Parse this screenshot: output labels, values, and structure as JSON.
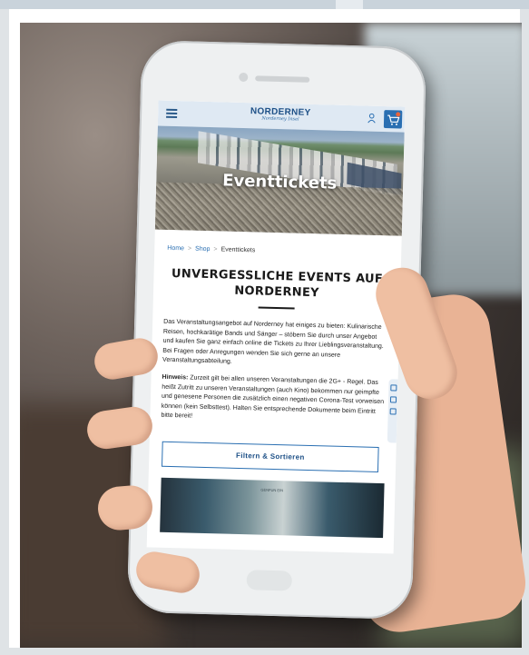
{
  "header": {
    "logo_main": "NORDERNEY",
    "logo_script": "Norderney Insel"
  },
  "hero": {
    "title": "Eventtickets"
  },
  "breadcrumb": {
    "home": "Home",
    "shop": "Shop",
    "current": "Eventtickets",
    "separator": ">"
  },
  "page": {
    "heading": "UNVERGESSLICHE EVENTS AUF NORDERNEY",
    "intro": "Das Veranstaltungsangebot auf Norderney hat einiges zu bieten: Kulinarische Reisen, hochkarätige Bands und Sänger – stöbern Sie durch unser Angebot und kaufen Sie ganz einfach online die Tickets zu Ihrer Lieblingsveranstaltung. Bei Fragen oder Anregungen wenden Sie sich gerne an unsere Veranstaltungsabteilung.",
    "notice_label": "Hinweis:",
    "notice_text": " Zurzeit gilt bei allen unseren Veranstaltungen die 2G+ - Regel. Das heißt Zutritt zu unseren Veranstaltungen (auch Kino) bekommen nur geimpfte und genesene Personen die zusätzlich einen negativen Corona-Test vorweisen können (kein Selbsttest). Halten Sie entsprechende Dokumente beim Eintritt bitte bereit!",
    "filter_label": "Filtern & Sortieren",
    "event_caption": "GENFUN EIN"
  },
  "colors": {
    "brand_blue": "#1c4f86",
    "accent_blue": "#2a6fb2",
    "header_bg": "#dfe9f3",
    "phone_body": "#eef0f1"
  }
}
